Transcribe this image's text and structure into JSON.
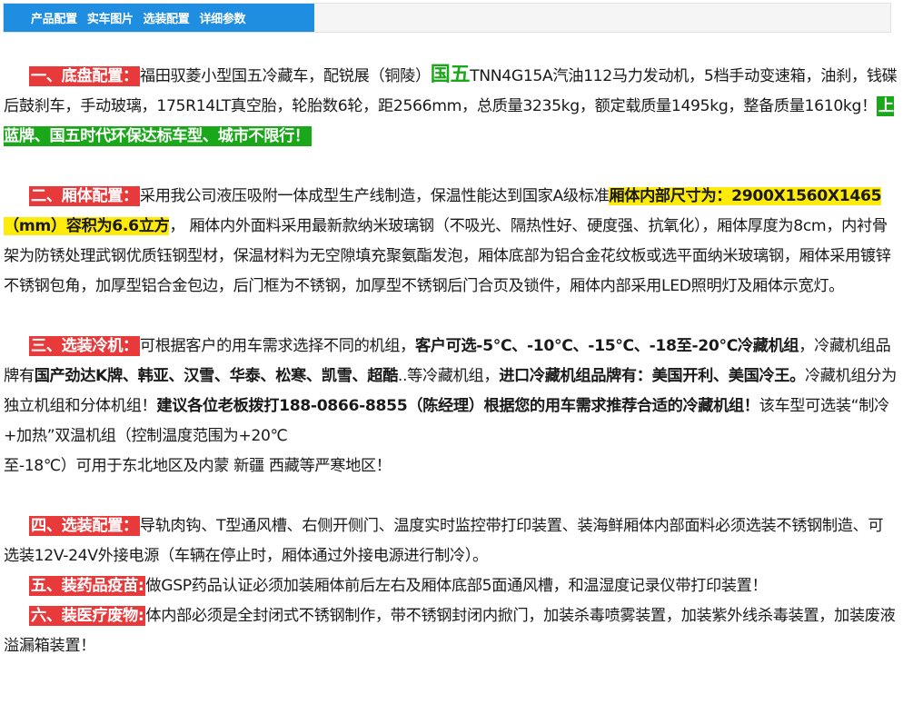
{
  "tabs": [
    "产品配置",
    "实车图片",
    "选装配置",
    "详细参数"
  ],
  "s1": {
    "heading": "一、底盘配置：",
    "text1": "福田驭菱小型国五冷藏车，配锐展（铜陵）",
    "guowu": "国五",
    "text2": "TNN4G15A汽油112马力发动机，5档手动变速箱，油刹，钱碟后鼓刹车，手动玻璃，175R14LT真空胎，轮胎数6轮，距2566mm，总质量3235kg，额定载质量1495kg，整备质量1610kg！",
    "green": "上蓝牌、国五时代环保达标车型、城市不限行！"
  },
  "s2": {
    "heading": "二、厢体配置：",
    "text1": "采用我公司液压吸附一体成型生产线制造，保温性能达到国家A级标准",
    "yellow": "厢体内部尺寸为：2900X1560X1465（mm）容积为6.6立方",
    "text2": "， 厢体内外面料采用最新款纳米玻璃钢（不吸光、隔热性好、硬度强、抗氧化），厢体厚度为8cm，内衬骨架为防锈处理武钢优质钰钢型材，保温材料为无空隙填充聚氨酯发泡，厢体底部为铝合金花纹板或选平面纳米玻璃钢，厢体采用镀锌不锈钢包角，加厚型铝合金包边，后门框为不锈钢，加厚型不锈钢后门合页及锁件，厢体内部采用LED照明灯及厢体示宽灯。"
  },
  "s3": {
    "heading": "三、选装冷机：",
    "text1": "可根据客户的用车需求选择不同的机组，",
    "bold1": "客户可选-5℃、-10℃、-15℃、-18至-20℃冷藏机组",
    "text2": "，冷藏机组品牌有",
    "bold2": "国产劲达K牌、韩亚、汉雪、华泰、松寒、凯雪、超酷",
    "text3": "..等冷藏机组，",
    "bold3": "进口冷藏机组品牌有：美国开利、美国冷王。",
    "text4": "冷藏机组分为独立机组和分体机组！",
    "bold4": "建议各位老板拨打188-0866-8855（陈经理）根据您的用车需求推荐合适的冷藏机组！",
    "text5": "该车型可选装“制冷+加热”双温机组（控制温度范围为+20℃",
    "text6": "至-18℃）可用于东北地区及内蒙 新疆 西藏等严寒地区！"
  },
  "s4": {
    "heading": "四、选装配置：",
    "text": "导轨肉钩、T型通风槽、右侧开侧门、温度实时监控带打印装置、装海鲜厢体内部面料必须选装不锈钢制造、可选装12V-24V外接电源（车辆在停止时，厢体通过外接电源进行制冷）。"
  },
  "s5": {
    "heading": "五、装药品疫苗:",
    "text": "做GSP药品认证必须加装厢体前后左右及厢体底部5面通风槽，和温湿度记录仪带打印装置！"
  },
  "s6": {
    "heading": "六、装医疗废物:",
    "text": "体内部必须是全封闭式不锈钢制作，带不锈钢封闭内掀门，加装杀毒喷雾装置，加装紫外线杀毒装置，加装废液溢漏箱装置！"
  }
}
